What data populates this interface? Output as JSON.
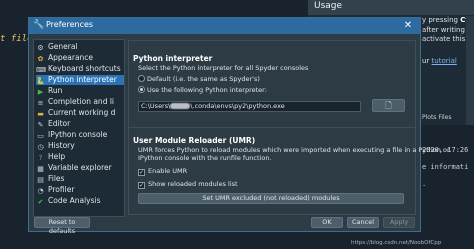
{
  "background": {
    "editor_fragment": "t file.",
    "usage_panel": {
      "title": "Usage",
      "lines": [
        {
          "text": "y pressing ",
          "bold": "Ctrl+I"
        },
        {
          "text": "after writing a left"
        },
        {
          "text": "activate this beha"
        },
        {
          "text": "ur ",
          "link": "tutorial"
        }
      ],
      "tabs": "Plots  Files",
      "console_lines": [
        "2020, 17:26",
        "e informati",
        "."
      ]
    }
  },
  "dialog": {
    "title": "Preferences",
    "pages": [
      {
        "label": "General",
        "icon": "general-icon",
        "selected": false
      },
      {
        "label": "Appearance",
        "icon": "appearance-icon",
        "selected": false
      },
      {
        "label": "Keyboard shortcuts",
        "icon": "keyboard-icon",
        "selected": false
      },
      {
        "label": "Python interpreter",
        "icon": "python-icon",
        "selected": true
      },
      {
        "label": "Run",
        "icon": "run-icon",
        "selected": false
      },
      {
        "label": "Completion and li",
        "icon": "completion-icon",
        "selected": false
      },
      {
        "label": "Current working d",
        "icon": "working-dir-icon",
        "selected": false
      },
      {
        "label": "Editor",
        "icon": "editor-icon",
        "selected": false
      },
      {
        "label": "IPython console",
        "icon": "ipython-icon",
        "selected": false
      },
      {
        "label": "History",
        "icon": "history-icon",
        "selected": false
      },
      {
        "label": "Help",
        "icon": "help-icon",
        "selected": false
      },
      {
        "label": "Variable explorer",
        "icon": "variable-explorer-icon",
        "selected": false
      },
      {
        "label": "Files",
        "icon": "files-icon",
        "selected": false
      },
      {
        "label": "Profiler",
        "icon": "profiler-icon",
        "selected": false
      },
      {
        "label": "Code Analysis",
        "icon": "code-analysis-icon",
        "selected": false
      }
    ],
    "interpreter": {
      "section_title": "Python interpreter",
      "description": "Select the Python interpreter for all Spyder consoles",
      "option_default": "Default (i.e. the same as Spyder's)",
      "option_custom": "Use the following Python interpreter:",
      "selected_option": "custom",
      "path_prefix": "C:\\Users\\",
      "path_suffix": "\\.conda\\envs\\py2\\python.exe"
    },
    "umr": {
      "section_title": "User Module Reloader (UMR)",
      "description_line1": "UMR forces Python to reload modules which were imported when executing a file in a Python or",
      "description_line2": "IPython console with the runfile function.",
      "enable_label": "Enable UMR",
      "enable_checked": true,
      "show_list_label": "Show reloaded modules list",
      "show_list_checked": true,
      "excluded_button": "Set UMR excluded (not reloaded) modules"
    },
    "buttons": {
      "reset": "Reset to defaults",
      "ok": "OK",
      "cancel": "Cancel",
      "apply": "Apply"
    }
  },
  "watermark": "https://blog.csdn.net/NoobOfCpp"
}
